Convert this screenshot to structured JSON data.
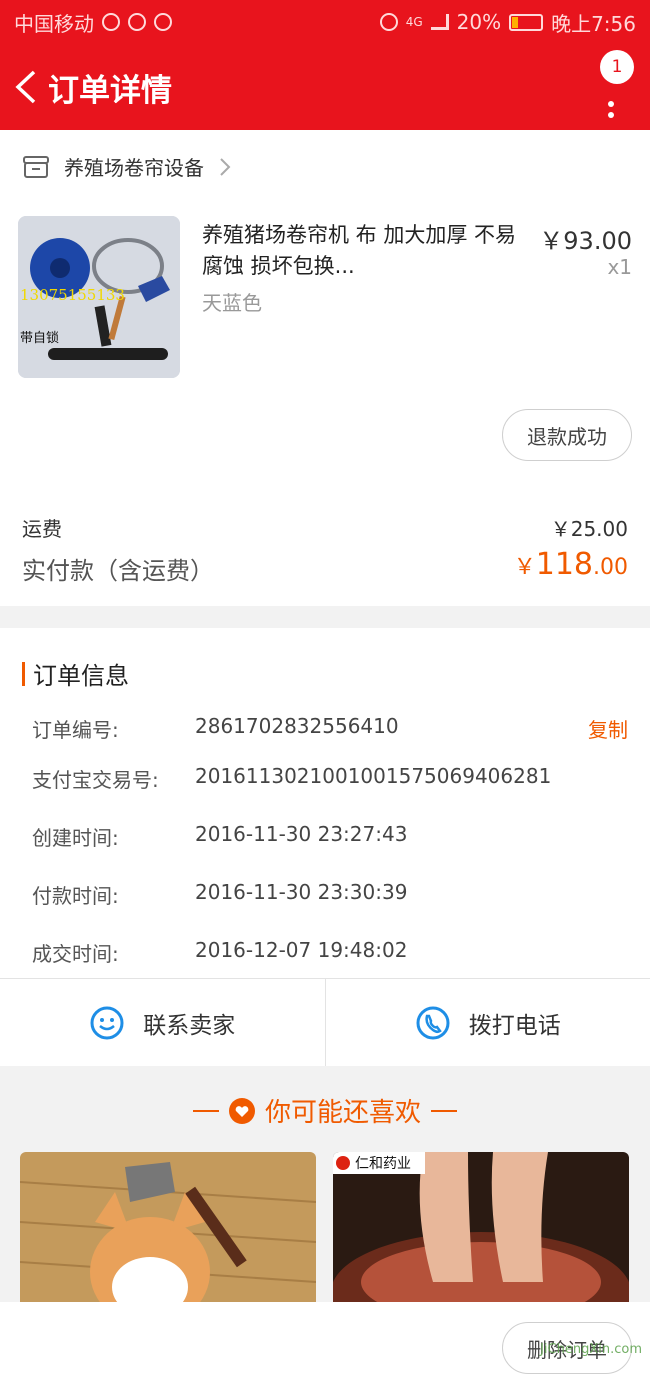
{
  "status_bar": {
    "carrier": "中国移动",
    "network": "4G",
    "battery": "20%",
    "time": "晚上7:56"
  },
  "header": {
    "title": "订单详情",
    "badge_count": "1"
  },
  "shop": {
    "name": "养殖场卷帘设备"
  },
  "product": {
    "name": "养殖猪场卷帘机 布 加大加厚 不易腐蚀 损坏包换...",
    "variant": "天蓝色",
    "price": "￥93.00",
    "quantity": "x1",
    "image_caption_number": "13075155133",
    "image_caption_text": "带自锁",
    "refund_status": "退款成功"
  },
  "totals": {
    "shipping_label": "运费",
    "shipping_value": "￥25.00",
    "paid_label": "实付款（含运费）",
    "paid_symbol": "￥",
    "paid_integer": "118",
    "paid_decimal": ".00"
  },
  "order_info": {
    "title": "订单信息",
    "copy_label": "复制",
    "rows": [
      {
        "label": "订单编号:",
        "value": "2861702832556410"
      },
      {
        "label": "支付宝交易号:",
        "value": "2016113021001001575069406281"
      },
      {
        "label": "创建时间:",
        "value": "2016-11-30 23:27:43"
      },
      {
        "label": "付款时间:",
        "value": "2016-11-30 23:30:39"
      },
      {
        "label": "成交时间:",
        "value": "2016-12-07 19:48:02"
      }
    ]
  },
  "actions": {
    "contact_seller": "联系卖家",
    "call_phone": "拨打电话"
  },
  "recommend": {
    "title": "你可能还喜欢",
    "right_brand": "仁和药业"
  },
  "bottom": {
    "delete_order": "删除订单",
    "watermark": "JiChengXin.com"
  },
  "colors": {
    "brand_red": "#e8141d",
    "accent_orange": "#f05a00"
  }
}
